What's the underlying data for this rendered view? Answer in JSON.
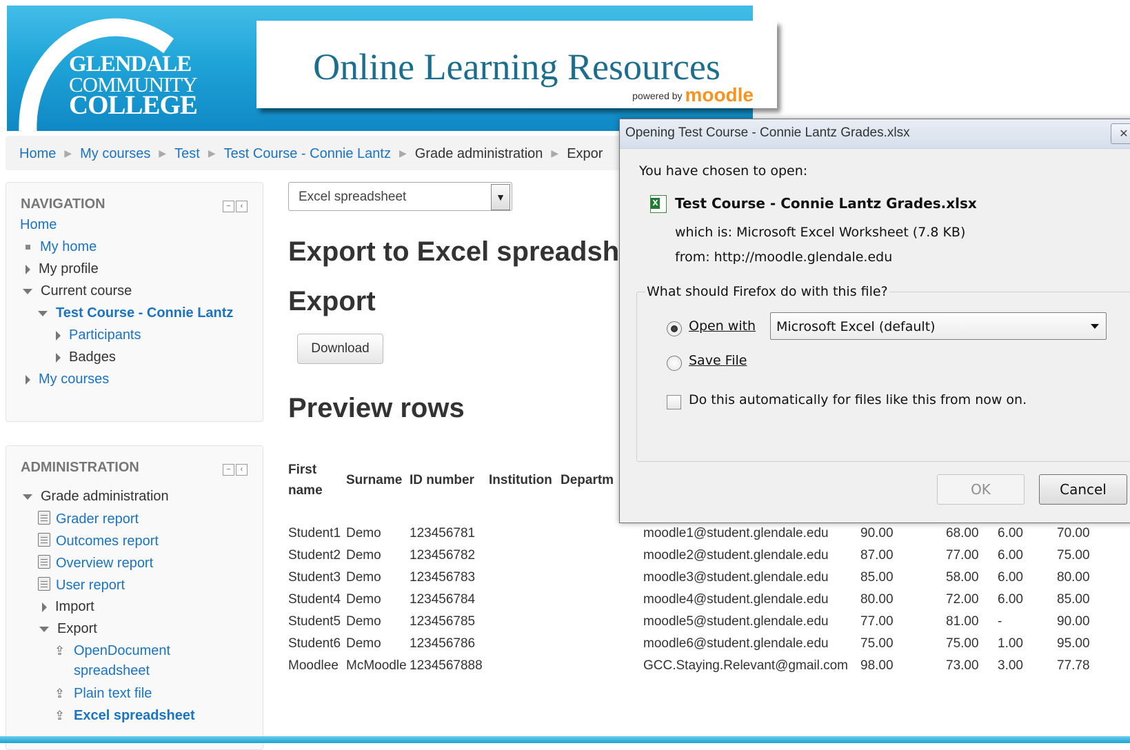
{
  "banner": {
    "college_line1": "GLENDALE",
    "college_line2": "COMMUNITY",
    "college_line3": "COLLEGE",
    "site_title": "Online Learning Resources",
    "powered_by": "powered by",
    "brand": "moodle"
  },
  "breadcrumb": [
    "Home",
    "My courses",
    "Test",
    "Test Course - Connie Lantz",
    "Grade administration",
    "Expor"
  ],
  "navigation": {
    "title": "NAVIGATION",
    "items": [
      "Home",
      "My home",
      "My profile",
      "Current course",
      "Test Course - Connie Lantz",
      "Participants",
      "Badges",
      "My courses"
    ]
  },
  "administration": {
    "title": "ADMINISTRATION",
    "items": [
      "Grade administration",
      "Grader report",
      "Outcomes report",
      "Overview report",
      "User report",
      "Import",
      "Export",
      "OpenDocument",
      "spreadsheet",
      "Plain text file",
      "Excel spreadsheet"
    ]
  },
  "main": {
    "format_select": "Excel spreadsheet",
    "heading_export_to": "Export to Excel spreadshe",
    "heading_export": "Export",
    "download_label": "Download",
    "heading_preview": "Preview rows",
    "table": {
      "headers": [
        "First",
        "name",
        "Surname",
        "ID number",
        "Institution",
        "Departm"
      ],
      "rows": [
        [
          "Student1",
          "Demo",
          "123456781",
          "moodle1@student.glendale.edu",
          "90.00",
          "68.00",
          "6.00",
          "70.00"
        ],
        [
          "Student2",
          "Demo",
          "123456782",
          "moodle2@student.glendale.edu",
          "87.00",
          "77.00",
          "6.00",
          "75.00"
        ],
        [
          "Student3",
          "Demo",
          "123456783",
          "moodle3@student.glendale.edu",
          "85.00",
          "58.00",
          "6.00",
          "80.00"
        ],
        [
          "Student4",
          "Demo",
          "123456784",
          "moodle4@student.glendale.edu",
          "80.00",
          "72.00",
          "6.00",
          "85.00"
        ],
        [
          "Student5",
          "Demo",
          "123456785",
          "moodle5@student.glendale.edu",
          "77.00",
          "81.00",
          "-",
          "90.00"
        ],
        [
          "Student6",
          "Demo",
          "123456786",
          "moodle6@student.glendale.edu",
          "75.00",
          "75.00",
          "1.00",
          "95.00"
        ],
        [
          "Moodlee",
          "McMoodle",
          "1234567888",
          "GCC.Staying.Relevant@gmail.com",
          "98.00",
          "73.00",
          "3.00",
          "77.78"
        ]
      ]
    }
  },
  "dialog": {
    "title": "Opening Test Course - Connie Lantz Grades.xlsx",
    "close_glyph": "✕",
    "prompt": "You have chosen to open:",
    "filename": "Test Course - Connie Lantz Grades.xlsx",
    "which_is": "which is:  Microsoft Excel Worksheet (7.8 KB)",
    "from": "from:  http://moodle.glendale.edu",
    "question": "What should Firefox do with this file?",
    "open_with_label": "Open with",
    "open_with_app": "Microsoft Excel (default)",
    "save_file_label": "Save File",
    "auto_label": "Do this automatically for files like this from now on.",
    "ok_label": "OK",
    "cancel_label": "Cancel"
  },
  "icons": {
    "collapse": "−",
    "dock": "‹",
    "dropdown": "▼",
    "export": "⇪",
    "excel_file": "X"
  }
}
